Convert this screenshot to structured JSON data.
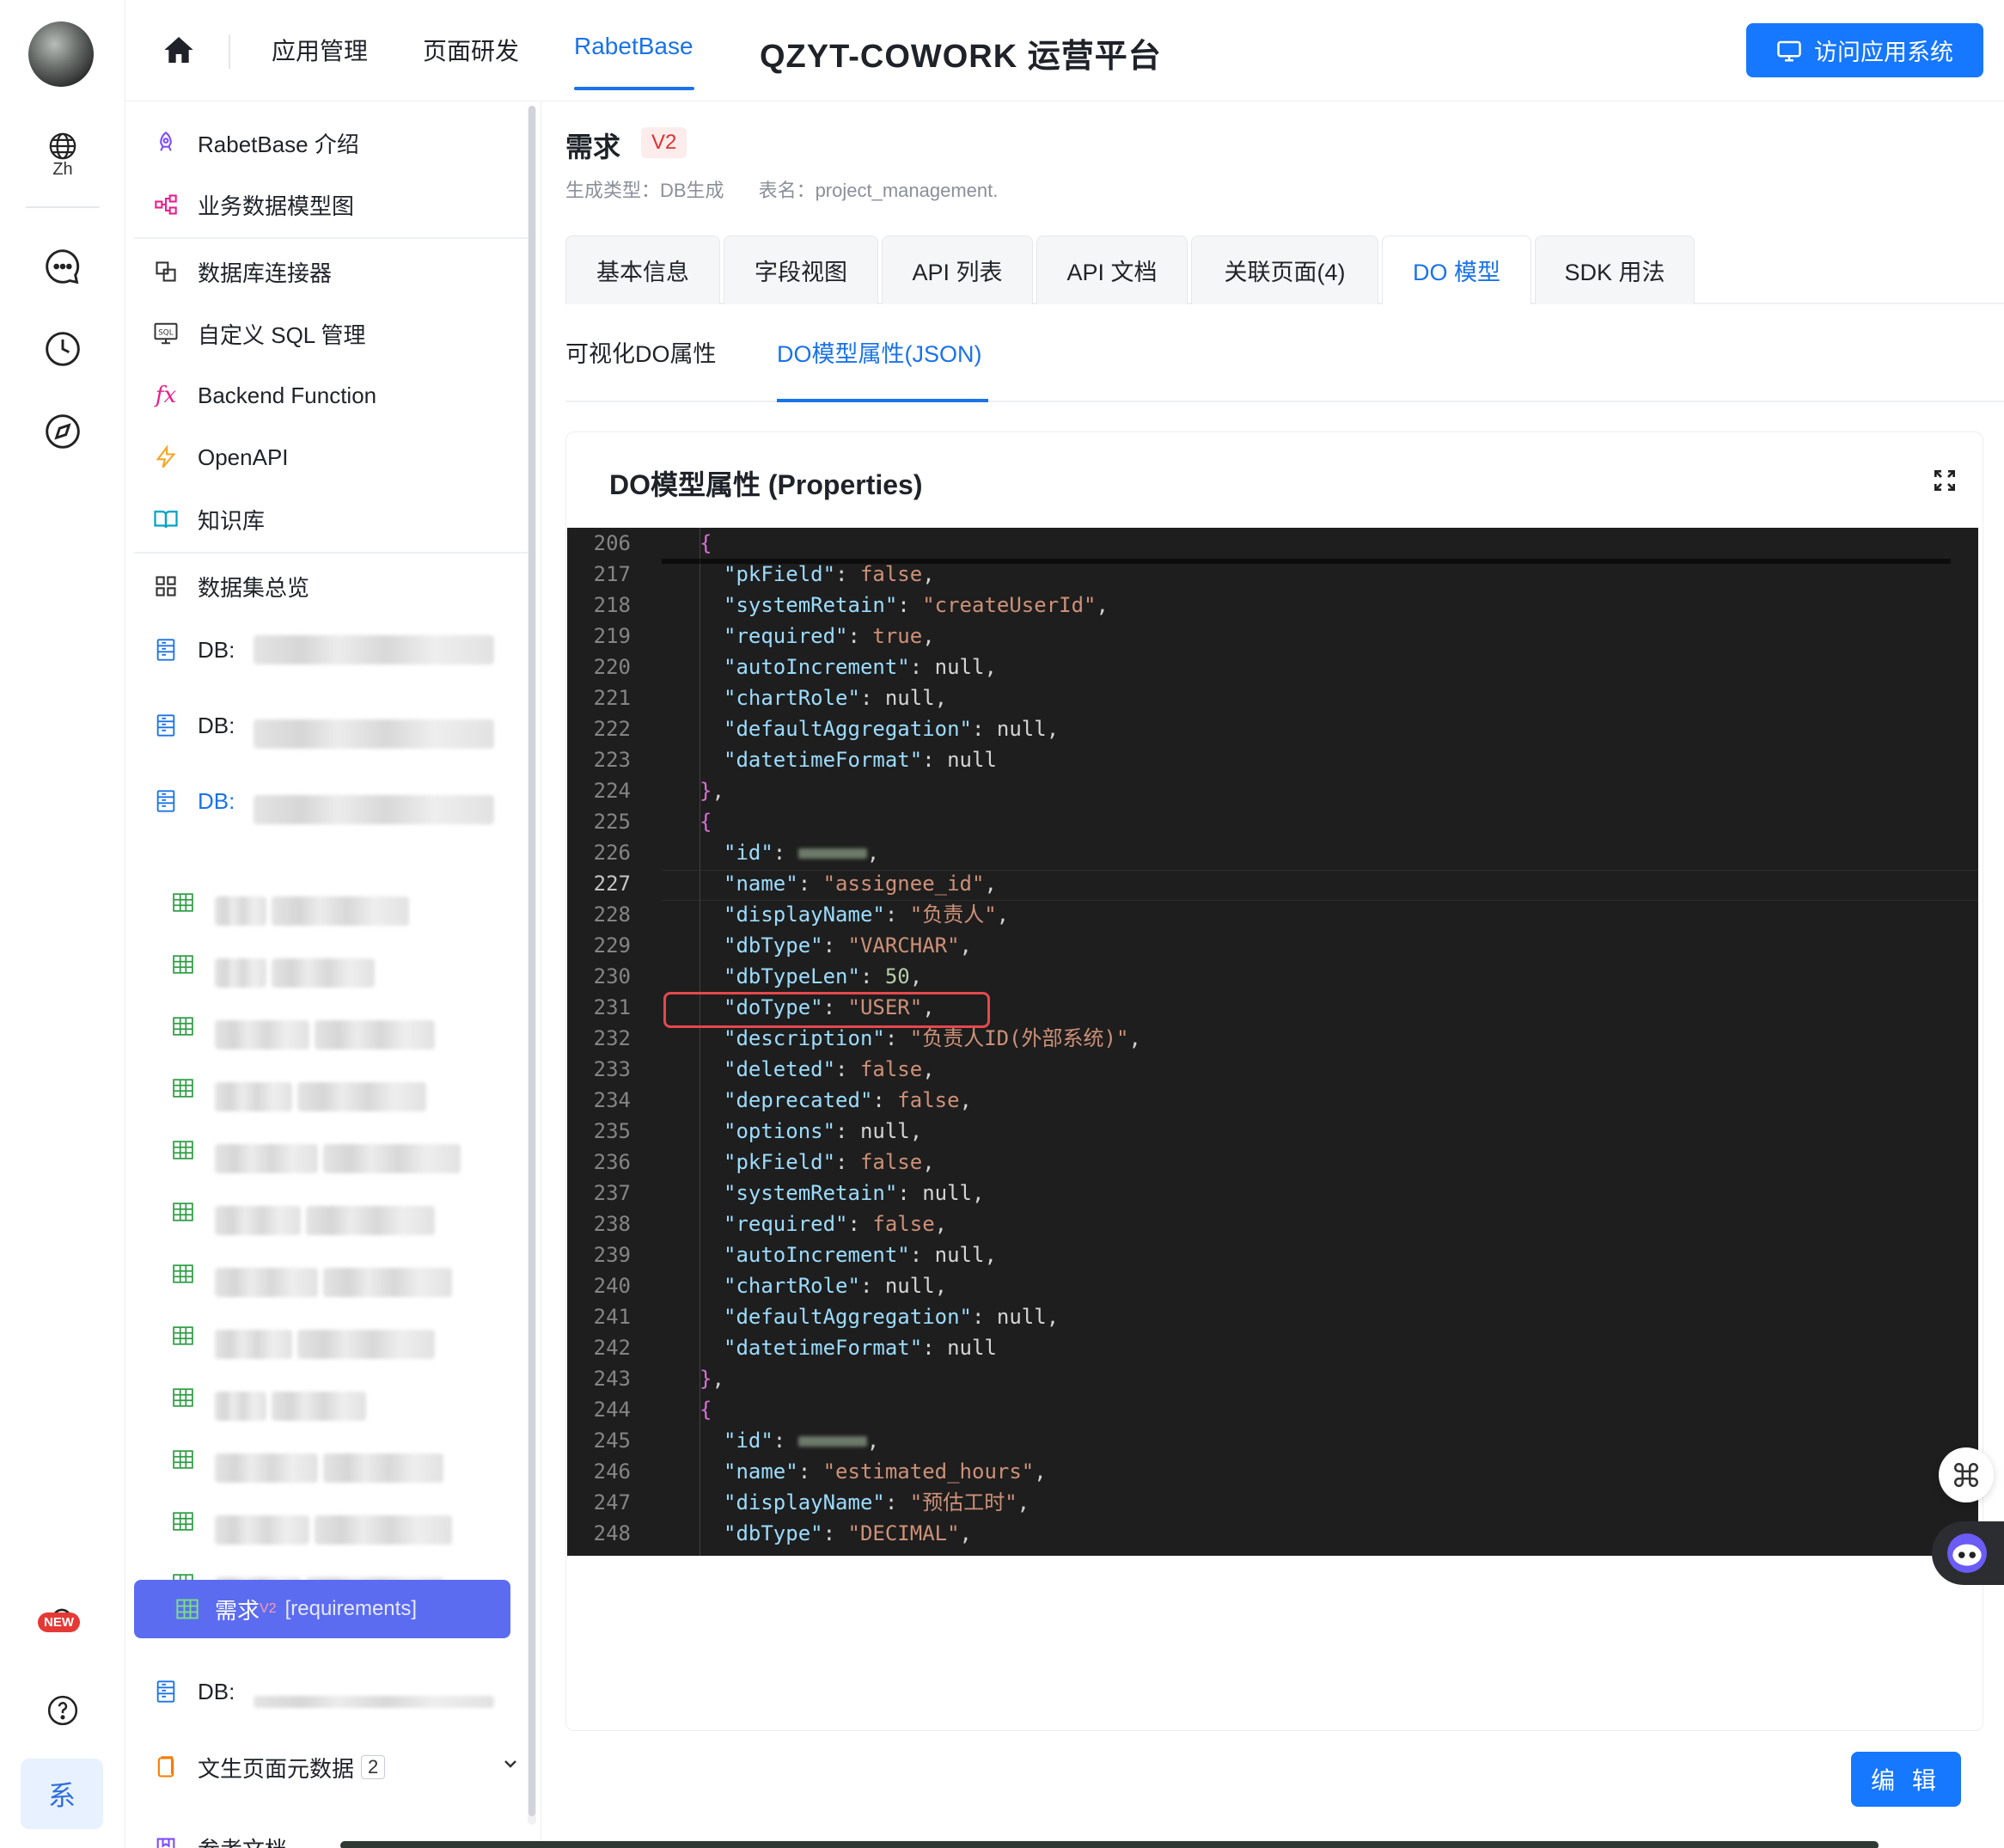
{
  "rail": {
    "lang_label": "Zh",
    "new_badge": "NEW",
    "system_button": "系"
  },
  "topnav": {
    "items": [
      "应用管理",
      "页面研发",
      "RabetBase"
    ],
    "active": "RabetBase",
    "app_title": "QZYT-COWORK 运营平台",
    "visit_button": "访问应用系统"
  },
  "sidebar": {
    "items": [
      {
        "label": "RabetBase 介绍",
        "icon": "rocket-icon"
      },
      {
        "label": "业务数据模型图",
        "icon": "diagram-icon"
      },
      {
        "label": "数据库连接器",
        "icon": "connector-icon"
      },
      {
        "label": "自定义 SQL 管理",
        "icon": "sql-icon"
      },
      {
        "label": "Backend Function",
        "icon": "function-icon"
      },
      {
        "label": "OpenAPI",
        "icon": "lightning-icon"
      },
      {
        "label": "知识库",
        "icon": "book-icon"
      },
      {
        "label": "数据集总览",
        "icon": "grid-icon"
      }
    ],
    "db_label": "DB:",
    "active_table": {
      "name": "需求",
      "version": "V2",
      "table": "[requirements]"
    },
    "page_meta": {
      "label": "文生页面元数据",
      "count": "2"
    },
    "ref_docs": "参考文档"
  },
  "main": {
    "title": "需求",
    "version_tag": "V2",
    "gen_type": "生成类型：DB生成",
    "table_name": "表名：project_management.",
    "tabs": [
      "基本信息",
      "字段视图",
      "API 列表",
      "API 文档",
      "关联页面(4)",
      "DO 模型",
      "SDK 用法"
    ],
    "active_tab": "DO 模型",
    "subtabs": [
      "可视化DO属性",
      "DO模型属性(JSON)"
    ],
    "active_subtab": "DO模型属性(JSON)",
    "panel_title": "DO模型属性 (Properties)",
    "edit_button": "编 辑"
  },
  "editor": {
    "lines": [
      {
        "n": "206",
        "text": "{"
      },
      {
        "n": "217",
        "text": "\"pkField\": false,"
      },
      {
        "n": "218",
        "text": "\"systemRetain\": \"createUserId\","
      },
      {
        "n": "219",
        "text": "\"required\": true,"
      },
      {
        "n": "220",
        "text": "\"autoIncrement\": null,"
      },
      {
        "n": "221",
        "text": "\"chartRole\": null,"
      },
      {
        "n": "222",
        "text": "\"defaultAggregation\": null,"
      },
      {
        "n": "223",
        "text": "\"datetimeFormat\": null"
      },
      {
        "n": "224",
        "text": "},"
      },
      {
        "n": "225",
        "text": "{"
      },
      {
        "n": "226",
        "text": "\"id\": ,"
      },
      {
        "n": "227",
        "text": "\"name\": \"assignee_id\","
      },
      {
        "n": "228",
        "text": "\"displayName\": \"负责人\","
      },
      {
        "n": "229",
        "text": "\"dbType\": \"VARCHAR\","
      },
      {
        "n": "230",
        "text": "\"dbTypeLen\": 50,"
      },
      {
        "n": "231",
        "text": "\"doType\": \"USER\","
      },
      {
        "n": "232",
        "text": "\"description\": \"负责人ID(外部系统)\","
      },
      {
        "n": "233",
        "text": "\"deleted\": false,"
      },
      {
        "n": "234",
        "text": "\"deprecated\": false,"
      },
      {
        "n": "235",
        "text": "\"options\": null,"
      },
      {
        "n": "236",
        "text": "\"pkField\": false,"
      },
      {
        "n": "237",
        "text": "\"systemRetain\": null,"
      },
      {
        "n": "238",
        "text": "\"required\": false,"
      },
      {
        "n": "239",
        "text": "\"autoIncrement\": null,"
      },
      {
        "n": "240",
        "text": "\"chartRole\": null,"
      },
      {
        "n": "241",
        "text": "\"defaultAggregation\": null,"
      },
      {
        "n": "242",
        "text": "\"datetimeFormat\": null"
      },
      {
        "n": "243",
        "text": "},"
      },
      {
        "n": "244",
        "text": "{"
      },
      {
        "n": "245",
        "text": "\"id\": ,"
      },
      {
        "n": "246",
        "text": "\"name\": \"estimated_hours\","
      },
      {
        "n": "247",
        "text": "\"displayName\": \"预估工时\","
      },
      {
        "n": "248",
        "text": "\"dbType\": \"DECIMAL\","
      }
    ],
    "current_line": "227",
    "highlighted_line": "231"
  }
}
